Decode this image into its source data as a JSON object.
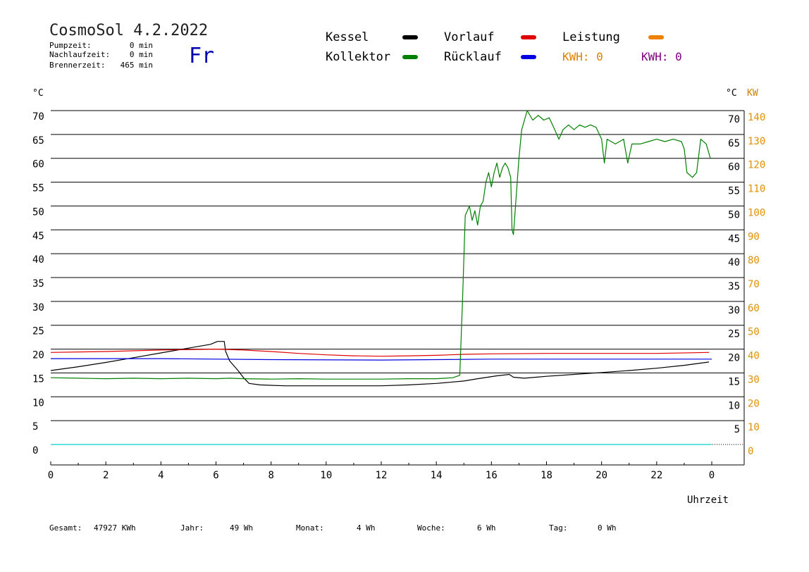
{
  "header": {
    "title": "CosmoSol 4.2.2022",
    "weekday": "Fr",
    "stats": [
      {
        "label": "Pumpzeit:",
        "value": "0 min"
      },
      {
        "label": "Nachlaufzeit:",
        "value": "0 min"
      },
      {
        "label": "Brennerzeit:",
        "value": "465 min"
      }
    ]
  },
  "legend": {
    "items": [
      {
        "label": "Kessel",
        "color": "#000000"
      },
      {
        "label": "Vorlauf",
        "color": "#e00000"
      },
      {
        "label": "Leistung",
        "color": "#f08000"
      },
      {
        "label": "Kollektor",
        "color": "#008000"
      },
      {
        "label": "Rücklauf",
        "color": "#0000e0"
      }
    ],
    "kwh": [
      {
        "text": "KWH: 0",
        "color": "#e08000"
      },
      {
        "text": "KWH: 0",
        "color": "#800080"
      }
    ]
  },
  "footer": {
    "items": [
      {
        "label": "Gesamt:",
        "value": "47927 KWh"
      },
      {
        "label": "Jahr:",
        "value": "49 Wh"
      },
      {
        "label": "Monat:",
        "value": "4 Wh"
      },
      {
        "label": "Woche:",
        "value": "6 Wh"
      },
      {
        "label": "Tag:",
        "value": "0 Wh"
      }
    ]
  },
  "chart_data": {
    "type": "line",
    "xlabel": "Uhrzeit",
    "y_unit_left": "°C",
    "y_unit_right_temp": "°C",
    "y_unit_right_power": "KW",
    "xlim": [
      0,
      24
    ],
    "ylim": [
      0,
      70
    ],
    "y2lim": [
      0,
      140
    ],
    "grid": true,
    "x_ticks": [
      0,
      2,
      4,
      6,
      8,
      10,
      12,
      14,
      16,
      18,
      20,
      22,
      24
    ],
    "x_tick_labels": [
      "0",
      "2",
      "4",
      "6",
      "8",
      "10",
      "12",
      "14",
      "16",
      "18",
      "20",
      "22",
      "0"
    ],
    "y_ticks": [
      0,
      5,
      10,
      15,
      20,
      25,
      30,
      35,
      40,
      45,
      50,
      55,
      60,
      65,
      70
    ],
    "y2_ticks": [
      0,
      10,
      20,
      30,
      40,
      50,
      60,
      70,
      80,
      90,
      100,
      110,
      120,
      130,
      140
    ],
    "series": [
      {
        "name": "Kessel",
        "color": "#000000",
        "points": [
          [
            0,
            15.5
          ],
          [
            1,
            16.3
          ],
          [
            2,
            17.2
          ],
          [
            3,
            18.2
          ],
          [
            4,
            19.2
          ],
          [
            5,
            20.2
          ],
          [
            5.8,
            21.0
          ],
          [
            6.05,
            21.6
          ],
          [
            6.3,
            21.6
          ],
          [
            6.35,
            19.5
          ],
          [
            6.5,
            17.5
          ],
          [
            6.8,
            15.5
          ],
          [
            7.0,
            14.0
          ],
          [
            7.2,
            12.8
          ],
          [
            7.6,
            12.5
          ],
          [
            8.5,
            12.3
          ],
          [
            10,
            12.3
          ],
          [
            12,
            12.3
          ],
          [
            13,
            12.5
          ],
          [
            14,
            12.8
          ],
          [
            15,
            13.3
          ],
          [
            15.5,
            13.8
          ],
          [
            16.2,
            14.4
          ],
          [
            16.65,
            14.7
          ],
          [
            16.8,
            14.1
          ],
          [
            17.2,
            13.9
          ],
          [
            18,
            14.3
          ],
          [
            19,
            14.7
          ],
          [
            20,
            15.1
          ],
          [
            21,
            15.5
          ],
          [
            22,
            16.0
          ],
          [
            23,
            16.6
          ],
          [
            23.9,
            17.3
          ]
        ]
      },
      {
        "name": "Vorlauf",
        "color": "#e00000",
        "points": [
          [
            0,
            19.3
          ],
          [
            2,
            19.5
          ],
          [
            4,
            19.8
          ],
          [
            6,
            20.0
          ],
          [
            7,
            19.8
          ],
          [
            8,
            19.5
          ],
          [
            9,
            19.1
          ],
          [
            10,
            18.8
          ],
          [
            11,
            18.6
          ],
          [
            12,
            18.5
          ],
          [
            13,
            18.6
          ],
          [
            14,
            18.7
          ],
          [
            15,
            18.9
          ],
          [
            16,
            19.0
          ],
          [
            18,
            19.1
          ],
          [
            20,
            19.1
          ],
          [
            22,
            19.1
          ],
          [
            23.9,
            19.3
          ]
        ]
      },
      {
        "name": "Rücklauf",
        "color": "#0000e0",
        "points": [
          [
            0,
            18.0
          ],
          [
            4,
            18.0
          ],
          [
            8,
            17.8
          ],
          [
            12,
            17.7
          ],
          [
            14,
            17.8
          ],
          [
            16,
            17.9
          ],
          [
            18,
            17.9
          ],
          [
            24,
            17.9
          ]
        ]
      },
      {
        "name": "Kollektor",
        "color": "#008000",
        "points": [
          [
            0,
            14.0
          ],
          [
            1,
            13.9
          ],
          [
            2,
            13.8
          ],
          [
            3,
            13.9
          ],
          [
            4,
            13.8
          ],
          [
            5,
            13.9
          ],
          [
            6,
            13.8
          ],
          [
            6.5,
            13.9
          ],
          [
            7,
            13.8
          ],
          [
            8,
            13.7
          ],
          [
            9,
            13.8
          ],
          [
            10,
            13.7
          ],
          [
            11,
            13.7
          ],
          [
            12,
            13.7
          ],
          [
            13,
            13.8
          ],
          [
            14,
            13.8
          ],
          [
            14.6,
            14.0
          ],
          [
            14.85,
            14.5
          ],
          [
            14.95,
            30
          ],
          [
            15.05,
            48
          ],
          [
            15.2,
            50
          ],
          [
            15.3,
            47
          ],
          [
            15.4,
            49
          ],
          [
            15.5,
            46
          ],
          [
            15.6,
            50
          ],
          [
            15.7,
            51
          ],
          [
            15.8,
            55
          ],
          [
            15.9,
            57
          ],
          [
            16.0,
            54
          ],
          [
            16.1,
            57
          ],
          [
            16.2,
            59
          ],
          [
            16.3,
            56
          ],
          [
            16.4,
            58
          ],
          [
            16.5,
            59
          ],
          [
            16.6,
            58
          ],
          [
            16.7,
            56
          ],
          [
            16.75,
            45
          ],
          [
            16.8,
            44
          ],
          [
            16.9,
            52
          ],
          [
            17.0,
            60
          ],
          [
            17.1,
            66
          ],
          [
            17.2,
            68
          ],
          [
            17.3,
            70
          ],
          [
            17.5,
            68
          ],
          [
            17.7,
            69
          ],
          [
            17.9,
            68
          ],
          [
            18.1,
            68.5
          ],
          [
            18.3,
            66
          ],
          [
            18.45,
            64
          ],
          [
            18.6,
            66
          ],
          [
            18.8,
            67
          ],
          [
            19.0,
            66
          ],
          [
            19.2,
            67
          ],
          [
            19.4,
            66.5
          ],
          [
            19.6,
            67
          ],
          [
            19.8,
            66.5
          ],
          [
            20.0,
            64
          ],
          [
            20.1,
            59
          ],
          [
            20.2,
            64
          ],
          [
            20.5,
            63
          ],
          [
            20.8,
            64
          ],
          [
            20.95,
            59
          ],
          [
            21.1,
            63
          ],
          [
            21.4,
            63
          ],
          [
            21.7,
            63.5
          ],
          [
            22.0,
            64
          ],
          [
            22.3,
            63.5
          ],
          [
            22.6,
            64
          ],
          [
            22.9,
            63.5
          ],
          [
            23.0,
            62
          ],
          [
            23.1,
            57
          ],
          [
            23.3,
            56
          ],
          [
            23.45,
            57
          ],
          [
            23.6,
            64
          ],
          [
            23.8,
            63
          ],
          [
            23.95,
            60
          ]
        ]
      },
      {
        "name": "Leistung",
        "color": "#00d0d0",
        "points": [
          [
            0,
            0
          ],
          [
            24,
            0
          ]
        ]
      }
    ]
  }
}
